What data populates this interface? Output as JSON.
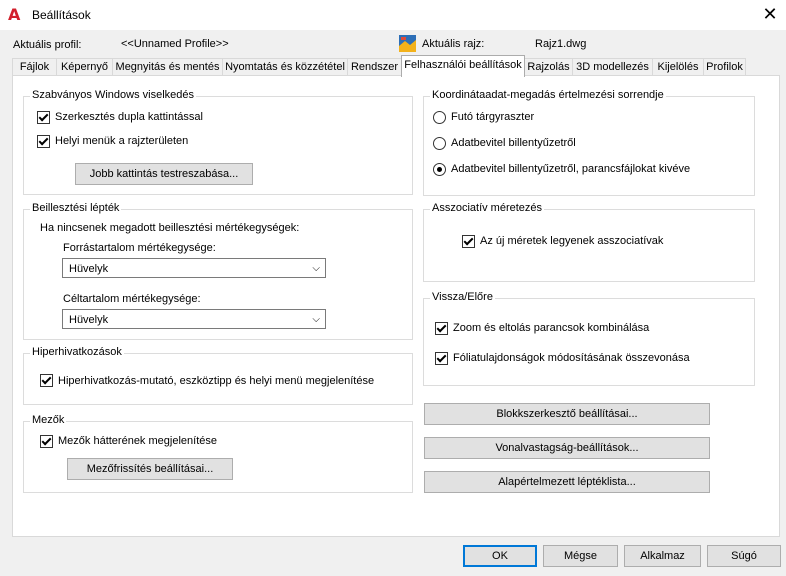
{
  "window": {
    "title": "Beállítások",
    "close_glyph": "✕"
  },
  "profile": {
    "label": "Aktuális profil:",
    "value": "<<Unnamed Profile>>",
    "drawing_label": "Aktuális rajz:",
    "drawing_value": "Rajz1.dwg"
  },
  "tabs": [
    {
      "label": "Fájlok"
    },
    {
      "label": "Képernyő"
    },
    {
      "label": "Megnyitás és mentés"
    },
    {
      "label": "Nyomtatás és közzététel"
    },
    {
      "label": "Rendszer"
    },
    {
      "label": "Felhasználói beállítások"
    },
    {
      "label": "Rajzolás"
    },
    {
      "label": "3D modellezés"
    },
    {
      "label": "Kijelölés"
    },
    {
      "label": "Profilok"
    }
  ],
  "windows_behavior": {
    "title": "Szabványos Windows viselkedés",
    "double_click": "Szerkesztés dupla kattintással",
    "shortcut_menus": "Helyi menük a rajzterületen",
    "right_click_button": "Jobb kattintás testreszabása..."
  },
  "insertion_scale": {
    "title": "Beillesztési lépték",
    "description": "Ha nincsenek megadott beillesztési mértékegységek:",
    "source_label": "Forrástartalom mértékegysége:",
    "source_value": "Hüvelyk",
    "target_label": "Céltartalom mértékegysége:",
    "target_value": "Hüvelyk"
  },
  "hyperlinks": {
    "title": "Hiperhivatkozások",
    "option": "Hiperhivatkozás-mutató, eszköztipp és helyi menü megjelenítése"
  },
  "fields": {
    "title": "Mezők",
    "option": "Mezők hátterének megjelenítése",
    "button": "Mezőfrissítés beállításai..."
  },
  "coordinate_priority": {
    "title": "Koordinátaadat-megadás értelmezési sorrendje",
    "options": [
      "Futó tárgyraszter",
      "Adatbevitel billentyűzetről",
      "Adatbevitel billentyűzetről, parancsfájlokat kivéve"
    ],
    "selected_index": 2
  },
  "associative": {
    "title": "Asszociatív méretezés",
    "option": "Az új méretek legyenek asszociatívak"
  },
  "undo_redo": {
    "title": "Vissza/Előre",
    "zoom_pan": "Zoom és eltolás parancsok kombinálása",
    "layer_props": "Fóliatulajdonságok módosításának összevonása"
  },
  "side_buttons": {
    "block_editor": "Blokkszerkesztő beállításai...",
    "lineweight": "Vonalvastagság-beállítások...",
    "scale_list": "Alapértelmezett léptéklista..."
  },
  "footer": {
    "ok": "OK",
    "cancel": "Mégse",
    "apply": "Alkalmaz",
    "help": "Súgó"
  },
  "colors": {
    "accent": "#0078d7",
    "logo": "#d21f2b"
  }
}
